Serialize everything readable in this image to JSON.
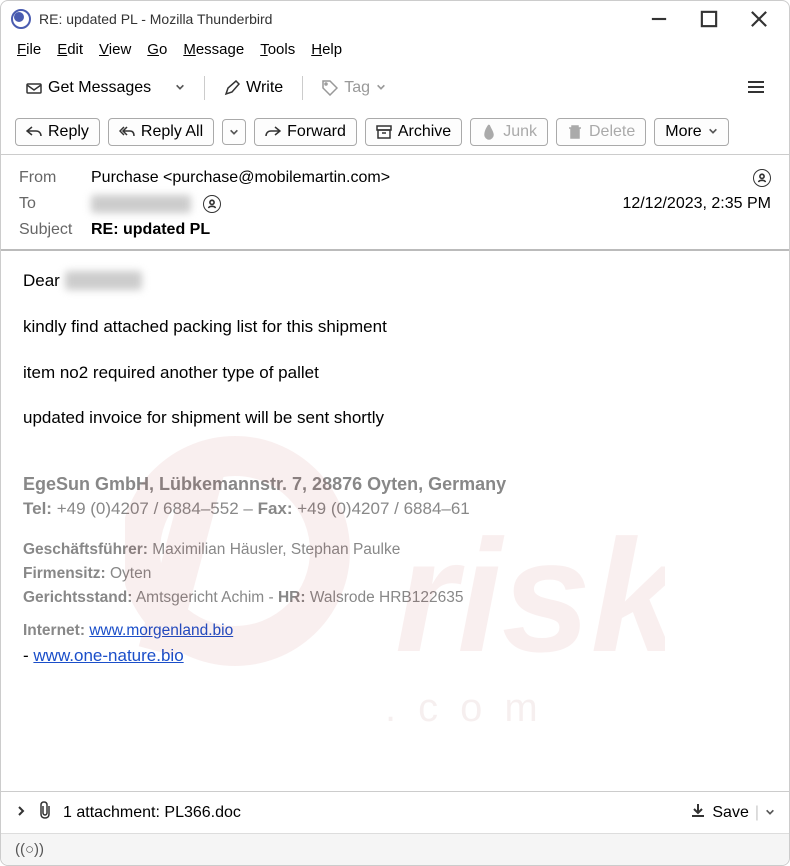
{
  "window": {
    "title": "RE: updated PL - Mozilla Thunderbird"
  },
  "menu": {
    "file": "File",
    "edit": "Edit",
    "view": "View",
    "go": "Go",
    "message": "Message",
    "tools": "Tools",
    "help": "Help"
  },
  "toolbar1": {
    "get_messages": "Get Messages",
    "write": "Write",
    "tag": "Tag"
  },
  "toolbar2": {
    "reply": "Reply",
    "reply_all": "Reply All",
    "forward": "Forward",
    "archive": "Archive",
    "junk": "Junk",
    "delete": "Delete",
    "more": "More"
  },
  "headers": {
    "from_label": "From",
    "from_value": "Purchase <purchase@mobilemartin.com>",
    "to_label": "To",
    "date": "12/12/2023, 2:35 PM",
    "subject_label": "Subject",
    "subject_value": "RE: updated PL"
  },
  "body": {
    "greeting": "Dear",
    "p1": "kindly find attached packing list for this shipment",
    "p2": "item no2 required another type of pallet",
    "p3": "updated invoice for shipment will be sent shortly",
    "sig_company": "EgeSun GmbH, Lübkemannstr. 7, 28876 Oyten, Germany",
    "sig_tel_label": "Tel:",
    "sig_tel": " +49 (0)4207 / 6884–552 – ",
    "sig_fax_label": "Fax:",
    "sig_fax": " +49 (0)4207 / 6884–61",
    "sig_gf_label": "Geschäftsführer:",
    "sig_gf": "   Maximilian Häusler, Stephan Paulke",
    "sig_fs_label": "Firmensitz:",
    "sig_fs": " Oyten",
    "sig_gs_label": "Gerichtsstand:",
    "sig_gs": " Amtsgericht Achim - ",
    "sig_hr_label": "HR:",
    "sig_hr": " Walsrode HRB122635",
    "sig_internet_label": "Internet:",
    "sig_link1": " www.morgenland.bio ",
    "sig_dash": "- ",
    "sig_link2": "www.one-nature.bio"
  },
  "attachment": {
    "text": "1 attachment: PL366.doc",
    "save": "Save"
  },
  "statusbar": {
    "icon": "((○))"
  }
}
